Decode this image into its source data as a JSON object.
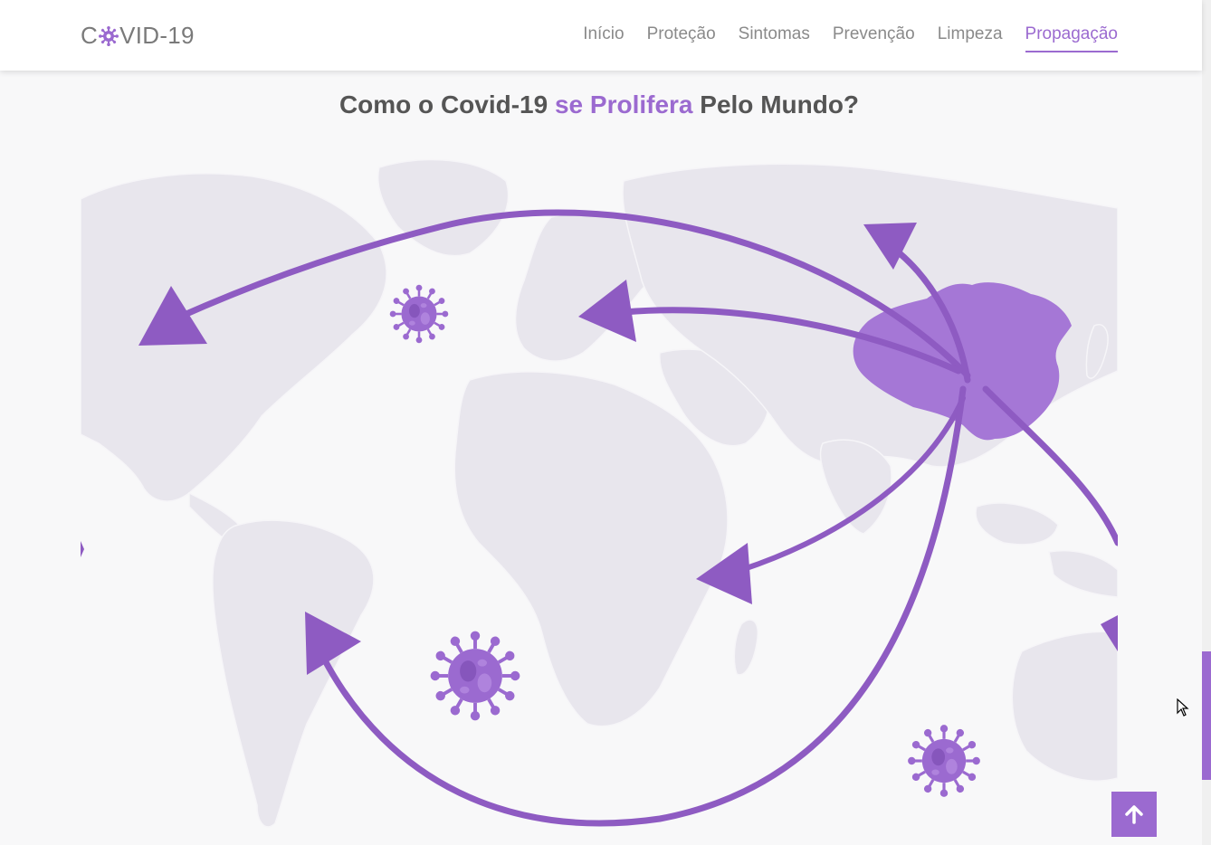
{
  "brand": {
    "prefix": "C",
    "suffix": "VID-19",
    "icon": "virus-icon"
  },
  "nav": {
    "items": [
      {
        "label": "Início",
        "active": false
      },
      {
        "label": "Proteção",
        "active": false
      },
      {
        "label": "Sintomas",
        "active": false
      },
      {
        "label": "Prevenção",
        "active": false
      },
      {
        "label": "Limpeza",
        "active": false
      },
      {
        "label": "Propagação",
        "active": true
      }
    ]
  },
  "heading": {
    "part1": "Como o Covid-19 ",
    "accent": "se Prolifera",
    "part2": " Pelo Mundo?"
  },
  "colors": {
    "accent": "#9b6ad0",
    "arrow": "#8e5bc2",
    "china": "#a577d6",
    "land": "#e8e6ed",
    "background": "#f8f8f9",
    "text": "#555555",
    "nav_text": "#8a8a8a"
  },
  "icons": {
    "back_to_top": "arrow-up-icon",
    "cursor": "mouse-pointer-icon"
  }
}
